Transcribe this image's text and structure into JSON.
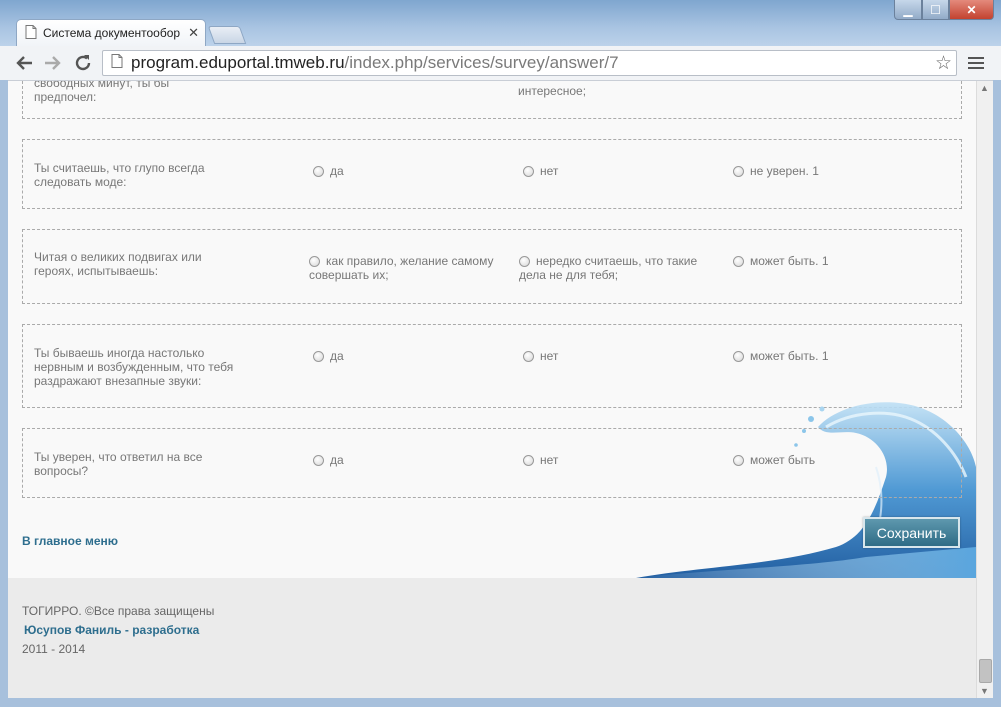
{
  "browser": {
    "tab_title": "Система документообор",
    "url_host": "program.eduportal.tmweb.ru",
    "url_path": "/index.php/services/survey/answer/7"
  },
  "partial_question": {
    "text": "свободных минут, ты бы предпочел:",
    "option2": "интересное;"
  },
  "questions": [
    {
      "text": "Ты считаешь, что глупо всегда следовать моде:",
      "options": [
        "да",
        "нет",
        "не уверен. 1"
      ]
    },
    {
      "text": "Читая о великих подвигах или героях, испытываешь:",
      "options": [
        "как правило, желание самому совершать их;",
        "нередко считаешь, что такие дела не для тебя;",
        "может быть. 1"
      ]
    },
    {
      "text": "Ты бываешь иногда настолько нервным и возбужденным, что тебя раздражают внезапные звуки:",
      "options": [
        "да",
        "нет",
        "может быть. 1"
      ]
    },
    {
      "text": "Ты уверен, что ответил на все вопросы?",
      "options": [
        "да",
        "нет",
        "может быть"
      ]
    }
  ],
  "actions": {
    "main_menu": "В главное меню",
    "save": "Сохранить"
  },
  "footer": {
    "copyright": "ТОГИРРО. ©Все права защищены",
    "developer": "Юсупов Фаниль - разработка",
    "years": "2011 - 2014"
  },
  "colors": {
    "link": "#2e6e8e",
    "save_button": "#3f7f98"
  }
}
